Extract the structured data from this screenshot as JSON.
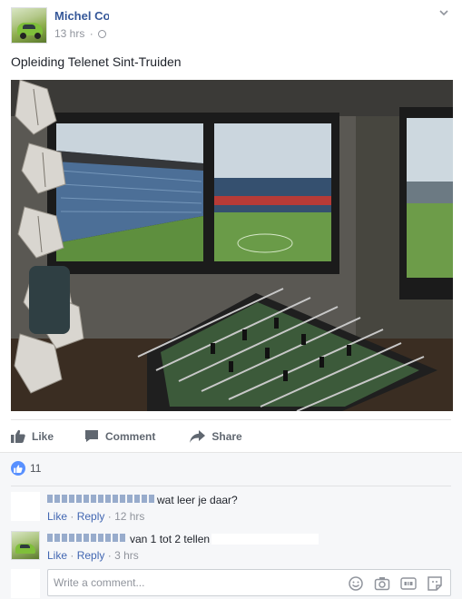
{
  "post": {
    "author": "Michel Co",
    "time": "13 hrs",
    "dot": "·",
    "text": "Opleiding Telenet Sint-Truiden"
  },
  "actions": {
    "like": "Like",
    "comment": "Comment",
    "share": "Share"
  },
  "reactions": {
    "count": "11"
  },
  "comments": [
    {
      "text": "wat leer je daar?",
      "like": "Like",
      "reply": "Reply",
      "sep": "·",
      "time": "12 hrs"
    },
    {
      "text": "van 1 tot 2 tellen",
      "like": "Like",
      "reply": "Reply",
      "sep": "·",
      "time": "3 hrs"
    }
  ],
  "composer": {
    "placeholder": "Write a comment..."
  },
  "colors": {
    "link": "#365899",
    "action_link": "#4267b2",
    "meta": "#90949c",
    "comments_bg": "#f6f7f9",
    "like_blue": "#5890ff"
  },
  "icons": {
    "privacy": "globe-icon",
    "menu": "chevron-down-icon",
    "like": "thumbs-up-icon",
    "comment": "speech-bubble-icon",
    "share": "share-arrow-icon",
    "emoji": "emoji-icon",
    "camera": "camera-icon",
    "gif": "gif-icon",
    "sticker": "sticker-icon"
  }
}
